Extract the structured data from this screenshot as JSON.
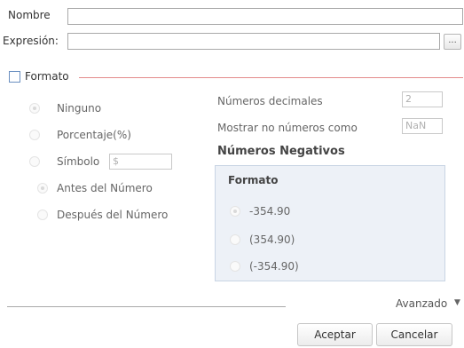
{
  "fields": {
    "nombre_label": "Nombre",
    "nombre_value": "",
    "expresion_label": "Expresión:",
    "expresion_value": "",
    "expresion_button": "..."
  },
  "formato": {
    "checkbox_label": "Formato",
    "checked": false
  },
  "format_options": {
    "ninguno": "Ninguno",
    "porcentaje": "Porcentaje(%)",
    "simbolo": "Símbolo",
    "simbolo_value": "$",
    "antes": "Antes del Número",
    "despues": "Después del Número"
  },
  "decimals": {
    "label": "Números decimales",
    "value": "2",
    "nan_label": "Mostrar no números como",
    "nan_value": "NaN"
  },
  "negativos": {
    "title": "Números Negativos",
    "panel_title": "Formato",
    "options": [
      "-354.90",
      "(354.90)",
      "(-354.90)"
    ]
  },
  "footer": {
    "avanzado": "Avanzado",
    "chevron_icon": "chevron-down-icon",
    "aceptar": "Aceptar",
    "cancelar": "Cancelar"
  }
}
